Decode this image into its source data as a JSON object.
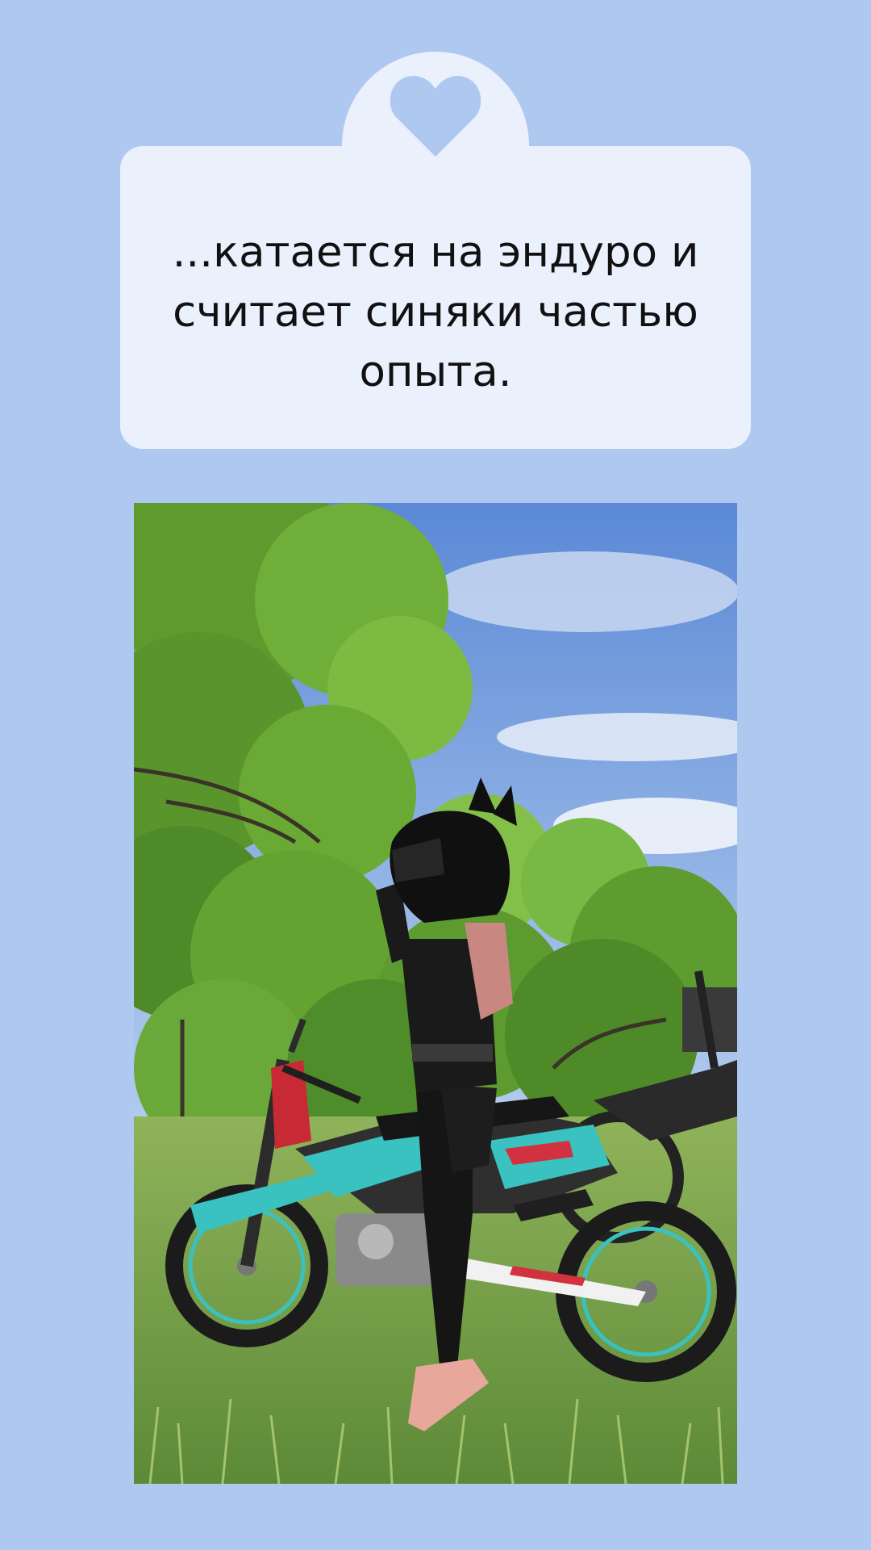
{
  "card": {
    "icon": "heart-icon",
    "text": "...катается на эндуро и\nсчитает синяки частью\nопыта."
  },
  "photo": {
    "icon": "photo-image"
  },
  "colors": {
    "background": "#aec8f0",
    "card": "#eaf0fc",
    "heart": "#aec8f0",
    "text": "#111111"
  }
}
